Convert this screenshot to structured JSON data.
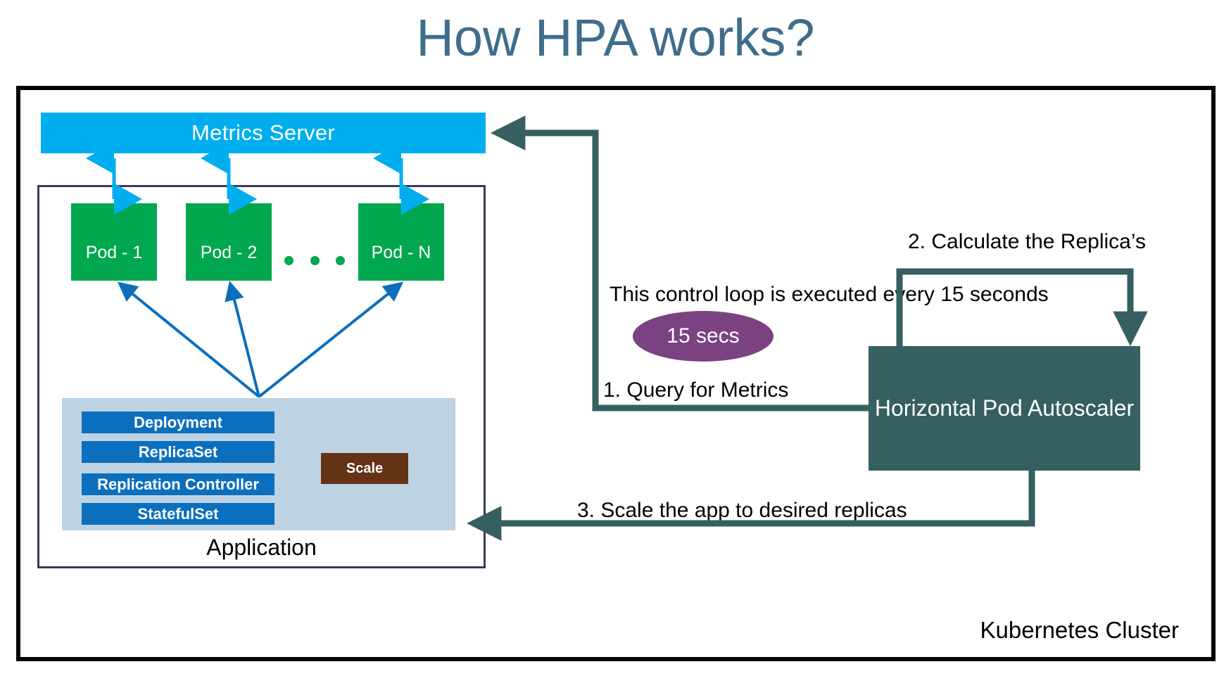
{
  "page": {
    "title": "How HPA works?",
    "title_color": "#3F6D8C",
    "background": "#ffffff"
  },
  "cluster": {
    "label": "Kubernetes Cluster",
    "border_color": "#000000"
  },
  "metrics_server": {
    "label": "Metrics Server",
    "color": "#00AEEF"
  },
  "application": {
    "label": "Application",
    "border_color": "#3A3A5C",
    "pods": [
      {
        "label": "Pod - 1"
      },
      {
        "label": "Pod - 2"
      },
      {
        "label": "Pod - N"
      }
    ],
    "pod_color": "#00A74F",
    "ellipsis": "...",
    "workload_panel_color": "#BDD3E3",
    "workloads": [
      {
        "label": "Deployment"
      },
      {
        "label": "ReplicaSet"
      },
      {
        "label": "Replication Controller"
      },
      {
        "label": "StatefulSet"
      }
    ],
    "workload_color": "#0B6FBE",
    "scale": {
      "label": "Scale",
      "color": "#643315"
    }
  },
  "autoscaler": {
    "label": "Horizontal Pod Autoscaler",
    "color": "#355F61"
  },
  "control_loop": {
    "note": "This control loop is executed every 15 seconds",
    "interval_label": "15 secs",
    "interval_color": "#7B4282"
  },
  "steps": [
    {
      "label": "1. Query for Metrics"
    },
    {
      "label": "2. Calculate the Replica’s"
    },
    {
      "label": "3. Scale the app to desired replicas"
    }
  ],
  "colors": {
    "teal_connector": "#355F61",
    "cyan_connector": "#00AEEF",
    "blue_connector": "#0B6FBE"
  }
}
